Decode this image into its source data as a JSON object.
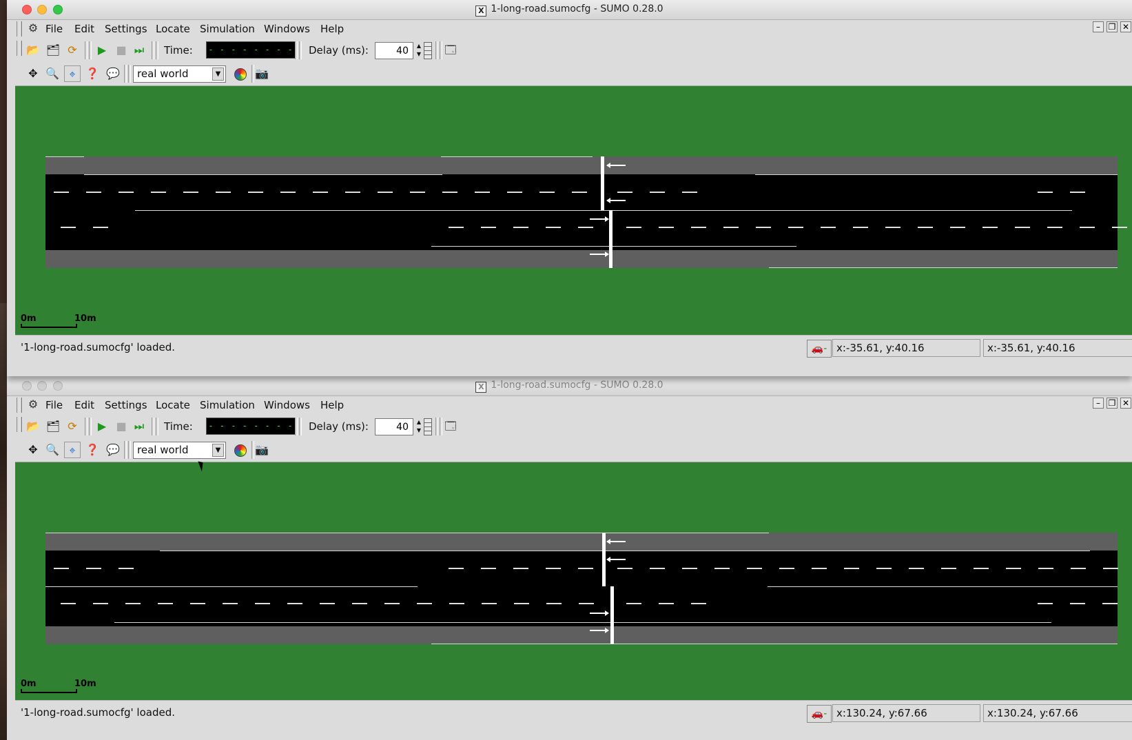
{
  "windows": [
    {
      "title": "1-long-road.sumocfg - SUMO 0.28.0",
      "menu": [
        "File",
        "Edit",
        "Settings",
        "Locate",
        "Simulation",
        "Windows",
        "Help"
      ],
      "time_label": "Time:",
      "time_value": "- - - - - - - - - - - -",
      "delay_label": "Delay (ms):",
      "delay_value": "40",
      "viewport": "real world",
      "scale_start": "0m",
      "scale_end": "10m",
      "status_message": "'1-long-road.sumocfg' loaded.",
      "car_button": "-",
      "coord1": "x:-35.61, y:40.16",
      "coord2": "x:-35.61, y:40.16"
    },
    {
      "title": "1-long-road.sumocfg - SUMO 0.28.0",
      "menu": [
        "File",
        "Edit",
        "Settings",
        "Locate",
        "Simulation",
        "Windows",
        "Help"
      ],
      "time_label": "Time:",
      "time_value": "- - - - - - - - - - - -",
      "delay_label": "Delay (ms):",
      "delay_value": "40",
      "viewport": "real world",
      "scale_start": "0m",
      "scale_end": "10m",
      "status_message": "'1-long-road.sumocfg' loaded.",
      "car_button": "-",
      "coord1": "x:130.24, y:67.66",
      "coord2": "x:130.24, y:67.66"
    }
  ],
  "icons": {
    "app": "sumo-app-icon",
    "open": "open-folder-icon",
    "reload": "reload-icon",
    "recent": "recent-files-icon",
    "run": "play-icon",
    "stop": "stop-icon",
    "step": "step-icon",
    "new_view": "new-view-icon",
    "recenter": "recenter-icon",
    "zoom": "zoom-icon",
    "select": "select-icon",
    "locate": "locate-junction-icon",
    "tooltip": "tooltip-icon",
    "colors": "color-wheel-icon",
    "screenshot": "camera-icon",
    "car": "car-icon"
  },
  "colors": {
    "canvas": "#318132",
    "road": "#000000",
    "sidewalk": "#5f5f5f",
    "time_text": "#3fd93f"
  }
}
